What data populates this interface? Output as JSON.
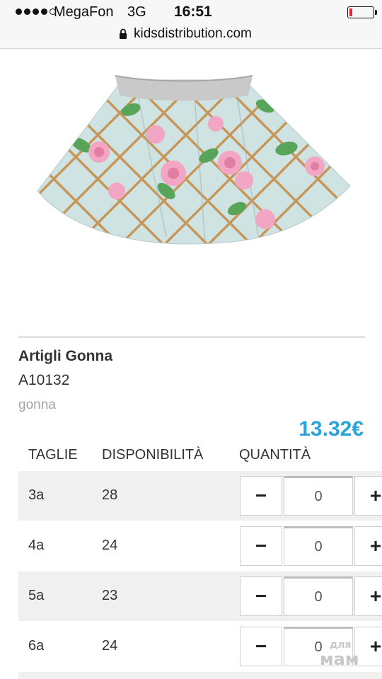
{
  "status_bar": {
    "carrier": "MegaFon",
    "network": "3G",
    "time": "16:51"
  },
  "browser": {
    "url": "kidsdistribution.com"
  },
  "product": {
    "name": "Artigli Gonna",
    "code": "A10132",
    "category": "gonna",
    "price": "13.32€",
    "image": "skirt-product-image"
  },
  "table": {
    "headers": [
      "TAGLIE",
      "DISPONIBILITÀ",
      "QUANTITÀ"
    ],
    "rows": [
      {
        "size": "3a",
        "availability": "28",
        "quantity": "0"
      },
      {
        "size": "4a",
        "availability": "24",
        "quantity": "0"
      },
      {
        "size": "5a",
        "availability": "23",
        "quantity": "0"
      },
      {
        "size": "6a",
        "availability": "24",
        "quantity": "0"
      }
    ]
  },
  "watermark": {
    "line1": "для",
    "line2": "мам"
  },
  "colors": {
    "price": "#2aa5dc",
    "row_shade": "#f0f0f0",
    "battery_low": "#e0262b"
  }
}
